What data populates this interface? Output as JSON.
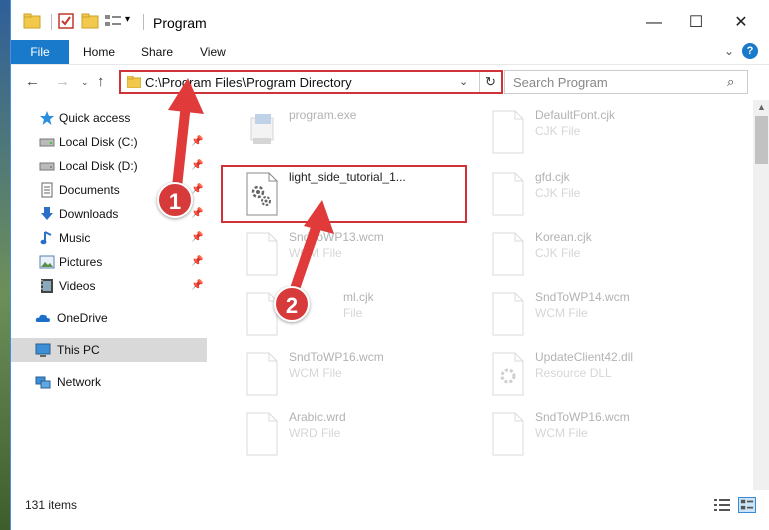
{
  "window": {
    "title": "Program",
    "min_glyph": "—",
    "max_glyph": "☐",
    "close_glyph": "✕"
  },
  "ribbon": {
    "tabs": [
      "File",
      "Home",
      "Share",
      "View"
    ],
    "expand_glyph": "⌄",
    "help_glyph": "?"
  },
  "nav": {
    "back_glyph": "←",
    "forward_glyph": "→",
    "recent_glyph": "⌄",
    "up_glyph": "↑"
  },
  "address": {
    "path": "C:\\Program Files\\Program Directory",
    "dropdown_glyph": "⌄",
    "refresh_glyph": "↻"
  },
  "search": {
    "placeholder": "Search Program",
    "icon_glyph": "⌕"
  },
  "sidebar": {
    "items": [
      {
        "label": "Quick access",
        "icon": "star-icon",
        "pinned": false
      },
      {
        "label": "Local Disk (C:)",
        "icon": "drive-icon",
        "pinned": true
      },
      {
        "label": "Local Disk (D:)",
        "icon": "drive-icon",
        "pinned": true
      },
      {
        "label": "Documents",
        "icon": "documents-icon",
        "pinned": true
      },
      {
        "label": "Downloads",
        "icon": "download-icon",
        "pinned": true
      },
      {
        "label": "Music",
        "icon": "music-icon",
        "pinned": true
      },
      {
        "label": "Pictures",
        "icon": "pictures-icon",
        "pinned": true
      },
      {
        "label": "Videos",
        "icon": "videos-icon",
        "pinned": true
      },
      {
        "label": "OneDrive",
        "icon": "cloud-icon",
        "pinned": false
      },
      {
        "label": "This PC",
        "icon": "computer-icon",
        "pinned": false,
        "selected": true
      },
      {
        "label": "Network",
        "icon": "network-icon",
        "pinned": false
      }
    ],
    "pin_glyph": "📌"
  },
  "files": [
    {
      "name": "program.exe",
      "type": "",
      "faded": true,
      "icon": "exe-icon"
    },
    {
      "name": "DefaultFont.cjk",
      "type": "CJK File",
      "faded": true,
      "icon": "file-icon"
    },
    {
      "name": "light_side_tutorial_1...",
      "type": "",
      "faded": false,
      "icon": "gear-file-icon"
    },
    {
      "name": "gfd.cjk",
      "type": "CJK File",
      "faded": true,
      "icon": "file-icon"
    },
    {
      "name": "SndToWP13.wcm",
      "type": "WCM File",
      "faded": true,
      "icon": "file-icon"
    },
    {
      "name": "Korean.cjk",
      "type": "CJK File",
      "faded": true,
      "icon": "file-icon"
    },
    {
      "name": "ml.cjk",
      "type": "File",
      "faded": true,
      "icon": "file-icon"
    },
    {
      "name": "SndToWP14.wcm",
      "type": "WCM File",
      "faded": true,
      "icon": "file-icon"
    },
    {
      "name": "SndToWP16.wcm",
      "type": "WCM File",
      "faded": true,
      "icon": "file-icon"
    },
    {
      "name": "UpdateClient42.dll",
      "type": "Resource DLL",
      "faded": true,
      "icon": "dll-icon"
    },
    {
      "name": "Arabic.wrd",
      "type": "WRD File",
      "faded": true,
      "icon": "file-icon"
    },
    {
      "name": "SndToWP16.wcm",
      "type": "WCM File",
      "faded": true,
      "icon": "file-icon"
    }
  ],
  "status": {
    "item_count": "131 items"
  },
  "markers": [
    "1",
    "2"
  ],
  "colors": {
    "accent": "#1979ca",
    "highlight": "#d0323a",
    "marker": "#d73a3a"
  }
}
